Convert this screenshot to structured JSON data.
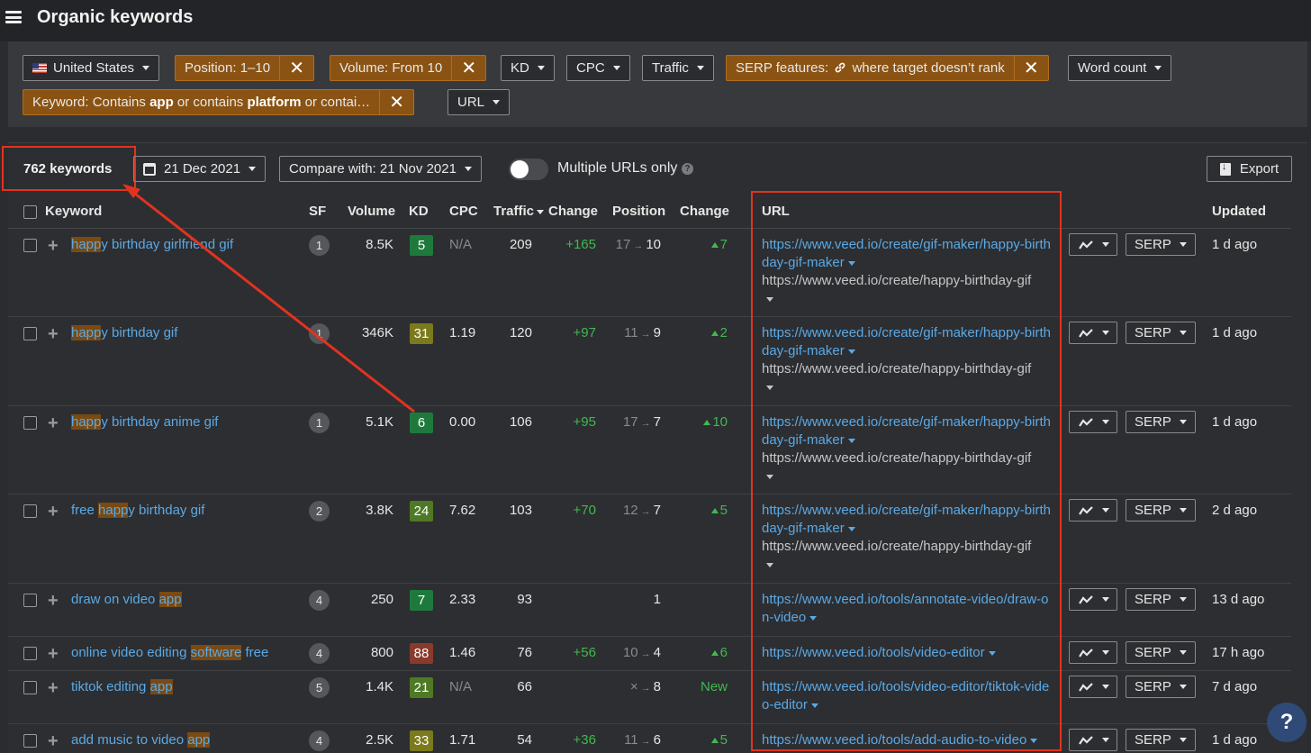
{
  "header": {
    "title": "Organic keywords"
  },
  "filters": {
    "country": "United States",
    "position": "Position: 1–10",
    "volume": "Volume: From 10",
    "kd": "KD",
    "cpc": "CPC",
    "traffic": "Traffic",
    "serp_prefix": "SERP features:",
    "serp_suffix": "where target doesn’t rank",
    "word_count": "Word count",
    "keyword_prefix": "Keyword: Contains ",
    "keyword_term1": "app",
    "keyword_mid": " or contains ",
    "keyword_term2": "platform",
    "keyword_tail": " or contai…",
    "url": "URL",
    "clear_icon": "✕"
  },
  "toolbar": {
    "count": "762 keywords",
    "date": "21 Dec 2021",
    "compare": "Compare with: 21 Nov 2021",
    "multiple_urls": "Multiple URLs only",
    "help": "?",
    "export": "Export"
  },
  "columns": {
    "keyword": "Keyword",
    "sf": "SF",
    "volume": "Volume",
    "kd": "KD",
    "cpc": "CPC",
    "traffic": "Traffic",
    "change": "Change",
    "position": "Position",
    "pos_change": "Change",
    "url": "URL",
    "updated": "Updated"
  },
  "rows": [
    {
      "kw_pre": "",
      "kw_hl": "happ",
      "kw_post": "y birthday girlfriend gif",
      "sf": "1",
      "volume": "8.5K",
      "kd": "5",
      "kd_color": "#1e7a3c",
      "cpc": "N/A",
      "traffic": "209",
      "change": "+165",
      "pos_from": "17",
      "pos_to": "10",
      "pos_change": "7",
      "url_main": "https://www.veed.io/create/gif-maker/happy-birthday-gif-maker",
      "url_sub": "https://www.veed.io/create/happy-birthday-gif",
      "serp": "SERP",
      "updated": "1 d ago"
    },
    {
      "kw_pre": "",
      "kw_hl": "happ",
      "kw_post": "y birthday gif",
      "sf": "1",
      "volume": "346K",
      "kd": "31",
      "kd_color": "#7b7a1c",
      "cpc": "1.19",
      "traffic": "120",
      "change": "+97",
      "pos_from": "11",
      "pos_to": "9",
      "pos_change": "2",
      "url_main": "https://www.veed.io/create/gif-maker/happy-birthday-gif-maker",
      "url_sub": "https://www.veed.io/create/happy-birthday-gif",
      "serp": "SERP",
      "updated": "1 d ago"
    },
    {
      "kw_pre": "",
      "kw_hl": "happ",
      "kw_post": "y birthday anime gif",
      "sf": "1",
      "volume": "5.1K",
      "kd": "6",
      "kd_color": "#1e7a3c",
      "cpc": "0.00",
      "traffic": "106",
      "change": "+95",
      "pos_from": "17",
      "pos_to": "7",
      "pos_change": "10",
      "url_main": "https://www.veed.io/create/gif-maker/happy-birthday-gif-maker",
      "url_sub": "https://www.veed.io/create/happy-birthday-gif",
      "serp": "SERP",
      "updated": "1 d ago"
    },
    {
      "kw_pre": "free ",
      "kw_hl": "happ",
      "kw_post": "y birthday gif",
      "sf": "2",
      "volume": "3.8K",
      "kd": "24",
      "kd_color": "#4f7a25",
      "cpc": "7.62",
      "traffic": "103",
      "change": "+70",
      "pos_from": "12",
      "pos_to": "7",
      "pos_change": "5",
      "url_main": "https://www.veed.io/create/gif-maker/happy-birthday-gif-maker",
      "url_sub": "https://www.veed.io/create/happy-birthday-gif",
      "serp": "SERP",
      "updated": "2 d ago"
    },
    {
      "kw_pre": "draw on video ",
      "kw_hl": "app",
      "kw_post": "",
      "sf": "4",
      "volume": "250",
      "kd": "7",
      "kd_color": "#1e7a3c",
      "cpc": "2.33",
      "traffic": "93",
      "change": "",
      "pos_from": "",
      "pos_to": "1",
      "pos_change": "",
      "url_main": "https://www.veed.io/tools/annotate-video/draw-on-video",
      "url_sub": "",
      "serp": "SERP",
      "updated": "13 d ago"
    },
    {
      "kw_pre": "online video editing ",
      "kw_hl": "software",
      "kw_post": " free",
      "sf": "4",
      "volume": "800",
      "kd": "88",
      "kd_color": "#8a3a2c",
      "cpc": "1.46",
      "traffic": "76",
      "change": "+56",
      "pos_from": "10",
      "pos_to": "4",
      "pos_change": "6",
      "url_main": "https://www.veed.io/tools/video-editor",
      "url_sub": "",
      "serp": "SERP",
      "updated": "17 h ago"
    },
    {
      "kw_pre": "tiktok editing ",
      "kw_hl": "app",
      "kw_post": "",
      "sf": "5",
      "volume": "1.4K",
      "kd": "21",
      "kd_color": "#4f7a25",
      "cpc": "N/A",
      "traffic": "66",
      "change": "",
      "pos_from": "×",
      "pos_to": "8",
      "pos_change": "New",
      "url_main": "https://www.veed.io/tools/video-editor/tiktok-video-editor",
      "url_sub": "",
      "serp": "SERP",
      "updated": "7 d ago"
    },
    {
      "kw_pre": "add music to video ",
      "kw_hl": "app",
      "kw_post": "",
      "sf": "4",
      "volume": "2.5K",
      "kd": "33",
      "kd_color": "#7b7a1c",
      "cpc": "1.71",
      "traffic": "54",
      "change": "+36",
      "pos_from": "11",
      "pos_to": "6",
      "pos_change": "5",
      "url_main": "https://www.veed.io/tools/add-audio-to-video",
      "url_sub": "",
      "serp": "SERP",
      "updated": "1 d ago"
    }
  ],
  "fab": "?"
}
